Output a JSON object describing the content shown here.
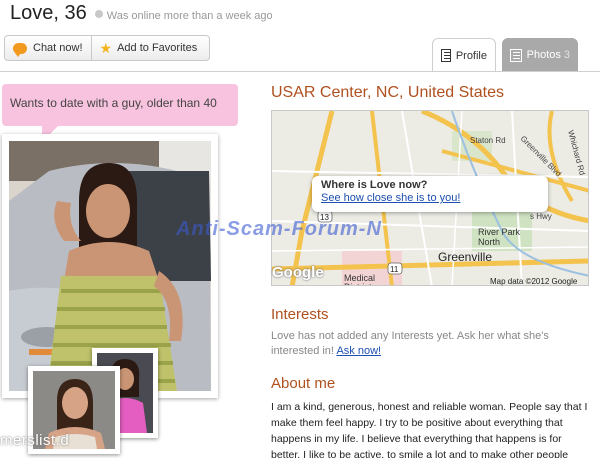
{
  "header": {
    "name": "Love, 36",
    "online_status": "Was online more than a week ago"
  },
  "actions": {
    "chat_label": "Chat now!",
    "favorites_label": "Add to Favorites"
  },
  "tabs": {
    "profile_label": "Profile",
    "photos_label": "Photos",
    "photos_count": "3"
  },
  "bubble": {
    "text": "Wants to date with a guy, older than 40"
  },
  "location": {
    "text": "USAR Center, NC, United States"
  },
  "map": {
    "popup_title": "Where is Love now?",
    "popup_link": "See how close she is to you!",
    "labels": {
      "greenville": "Greenville",
      "river_park": "River Park\nNorth",
      "medical": "Medical\nDistrict",
      "staton_rd": "Staton Rd",
      "greenville_blvd": "Greenville Blvd",
      "whichard_rd": "Whichard Rd",
      "hwy": "s Hwy",
      "route_11": "11",
      "route_13": "13"
    },
    "copyright": "Map data ©2012 Google",
    "logo": "Google"
  },
  "interests": {
    "title": "Interests",
    "text": "Love has not added any Interests yet. Ask her what she's interested in!",
    "ask_link": "Ask now!"
  },
  "about": {
    "title": "About me",
    "text": "I am a kind, generous, honest and reliable woman. People say that I make them feel happy. I try to be positive about everything that happens in my life. I believe that everything that happens is for better. I like to be active, to smile a lot and to make other people smiling! I don't"
  },
  "watermarks": {
    "center": "Anti-Scam-Forum-N",
    "left": "merslist.d"
  },
  "colors": {
    "accent": "#b0501e",
    "bubble": "#f8c3df",
    "link": "#1c4fb0",
    "tab_inactive": "#a9a9a9"
  }
}
